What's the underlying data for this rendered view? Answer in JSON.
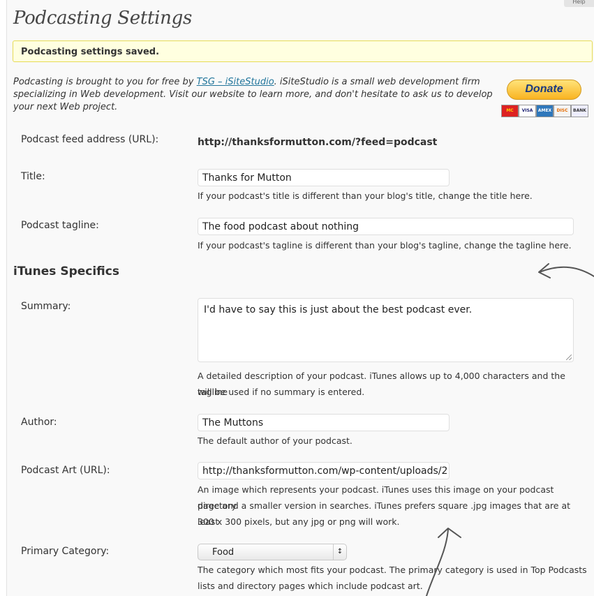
{
  "help_tab": "Help",
  "page_title": "Podcasting Settings",
  "notice": "Podcasting settings saved.",
  "intro": {
    "prefix": "Podcasting is brought to you for free by ",
    "link": "TSG – iSiteStudio",
    "suffix": ". iSiteStudio is a small web development firm specializing in Web development. Visit our website to learn more, and don't hesitate to ask us to develop your next Web project."
  },
  "donate": {
    "label": "Donate",
    "cards": [
      "MC",
      "VISA",
      "AMEX",
      "DISC",
      "BANK"
    ]
  },
  "fields": {
    "feed": {
      "label": "Podcast feed address (URL):",
      "value": "http://thanksformutton.com/?feed=podcast"
    },
    "title": {
      "label": "Title:",
      "value": "Thanks for Mutton",
      "help": "If your podcast's title is different than your blog's title, change the title here."
    },
    "tagline": {
      "label": "Podcast tagline:",
      "value": "The food podcast about nothing",
      "help": "If your podcast's tagline is different than your blog's tagline, change the tagline here."
    }
  },
  "itunes": {
    "heading": "iTunes Specifics",
    "summary": {
      "label": "Summary:",
      "value": "I'd have to say this is just about the best podcast ever.",
      "help_line1": "A detailed description of your podcast. iTunes allows up to 4,000 characters and the tagline",
      "help_line2": "will be used if no summary is entered."
    },
    "author": {
      "label": "Author:",
      "value": "The Muttons",
      "help": "The default author of your podcast."
    },
    "art": {
      "label": "Podcast Art (URL):",
      "value": "http://thanksformutton.com/wp-content/uploads/2",
      "help_line1": "An image which represents your podcast. iTunes uses this image on your podcast directory",
      "help_line2": "page and a smaller version in searches. iTunes prefers square .jpg images that are at least",
      "help_line3": "300 x 300 pixels, but any jpg or png will work."
    },
    "category": {
      "label": "Primary Category:",
      "selected": "Food",
      "help_line1": "The category which most fits your podcast. The primary category is used in Top Podcasts",
      "help_line2": "lists and directory pages which include podcast art."
    }
  },
  "colors": {
    "notice_bg": "#ffffe0",
    "notice_border": "#e6db55",
    "link": "#21759b",
    "annotation": "#555555"
  }
}
